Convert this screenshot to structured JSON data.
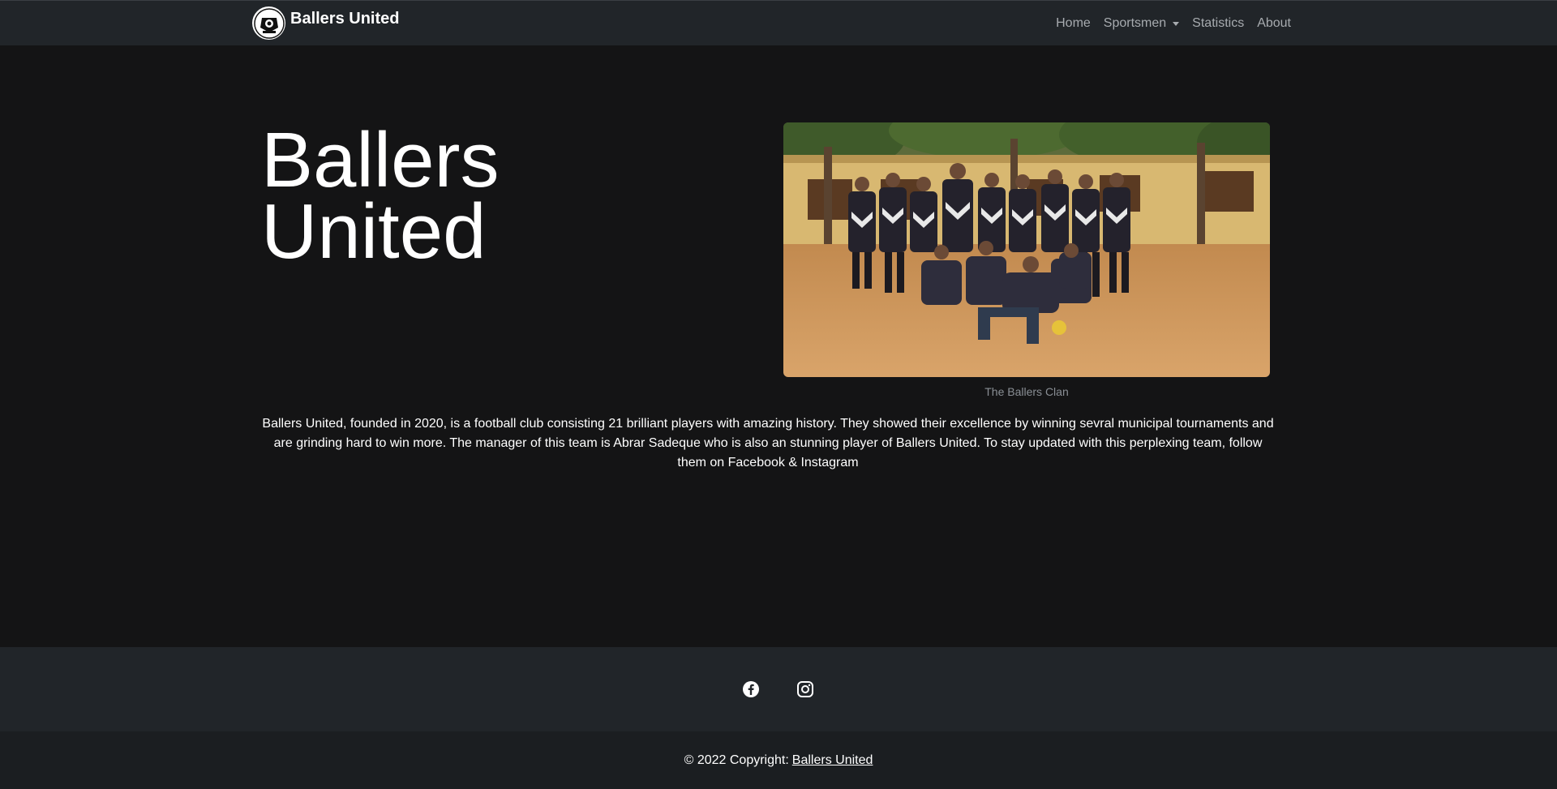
{
  "navbar": {
    "brand": "Ballers United",
    "links": [
      {
        "label": "Home"
      },
      {
        "label": "Sportsmen"
      },
      {
        "label": "Statistics"
      },
      {
        "label": "About"
      }
    ]
  },
  "hero": {
    "title_line1": "Ballers",
    "title_line2": "United",
    "image_caption": "The Ballers Clan",
    "about_text": "Ballers United, founded in 2020, is a football club consisting 21 brilliant players with amazing history. They showed their excellence by winning sevral municipal tournaments and are grinding hard to win more. The manager of this team is Abrar Sadeque who is also an stunning player of Ballers United. To stay updated with this perplexing team, follow them on Facebook & Instagram"
  },
  "footer": {
    "social": [
      {
        "icon": "facebook-icon"
      },
      {
        "icon": "instagram-icon"
      }
    ],
    "copyright_prefix": "© 2022 Copyright:",
    "copyright_link": "Ballers United"
  },
  "colors": {
    "background": "#141415",
    "navbar": "#212529",
    "footer_bottom": "#1b1e21",
    "nav_link": "#a7abaf"
  }
}
